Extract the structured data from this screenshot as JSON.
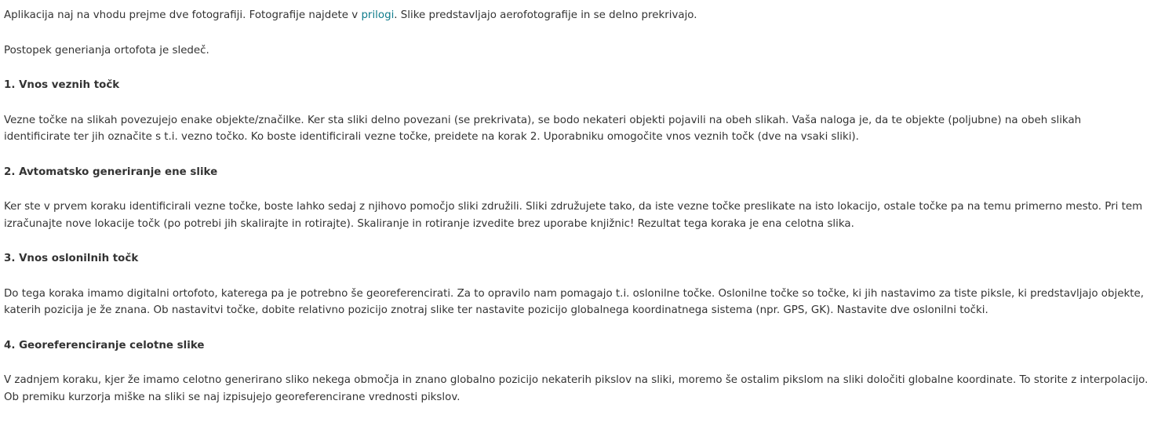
{
  "intro": {
    "before_link": "Aplikacija naj na vhodu prejme dve fotografiji. Fotografije najdete v ",
    "link_text": "prilogi",
    "after_link": ". Slike predstavljajo aerofotografije in se delno prekrivajo."
  },
  "procedure_intro": "Postopek generianja ortofota je sledeč.",
  "sections": [
    {
      "heading": "1. Vnos veznih točk",
      "body": "Vezne točke na slikah povezujejo enake objekte/značilke. Ker sta sliki delno povezani (se prekrivata), se bodo nekateri objekti pojavili na obeh slikah. Vaša naloga je, da te objekte (poljubne) na obeh slikah identificirate ter jih označite s t.i. vezno točko. Ko boste identificirali vezne točke, preidete na korak 2. Uporabniku omogočite vnos veznih točk (dve na vsaki sliki)."
    },
    {
      "heading": "2. Avtomatsko generiranje ene slike",
      "body": "Ker ste v prvem koraku identificirali vezne točke, boste lahko sedaj z njihovo pomočjo sliki združili. Sliki združujete tako, da iste vezne točke preslikate na isto lokacijo, ostale točke pa na temu primerno mesto. Pri tem izračunajte nove lokacije točk (po potrebi jih skalirajte in rotirajte). Skaliranje in rotiranje izvedite brez uporabe knjižnic! Rezultat tega koraka je ena celotna slika."
    },
    {
      "heading": "3. Vnos oslonilnih točk",
      "body": "Do tega koraka imamo digitalni ortofoto, katerega pa je potrebno še georeferencirati. Za to opravilo nam pomagajo t.i. oslonilne točke. Oslonilne točke so točke, ki jih nastavimo za tiste piksle, ki predstavljajo objekte, katerih pozicija je že znana. Ob nastavitvi točke, dobite relativno pozicijo znotraj slike ter nastavite pozicijo globalnega koordinatnega sistema (npr. GPS, GK). Nastavite dve oslonilni točki."
    },
    {
      "heading": "4. Georeferenciranje celotne slike",
      "body": "V zadnjem koraku, kjer že imamo celotno generirano sliko nekega območja in znano globalno pozicijo nekaterih pikslov na sliki, moremo še ostalim pikslom na sliki določiti globalne koordinate. To storite z interpolacijo. Ob premiku kurzorja miške na sliki se naj izpisujejo georeferencirane vrednosti pikslov."
    }
  ],
  "colors": {
    "text": "#333333",
    "link": "#0f7c8c",
    "background": "#ffffff"
  }
}
